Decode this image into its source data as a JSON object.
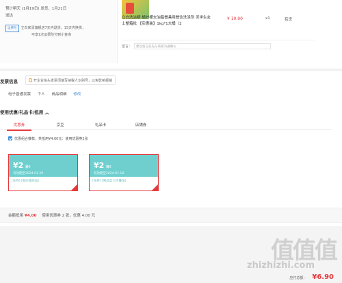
{
  "delivery": {
    "line1": "预计明天 (1月19日) 发货，1月21日",
    "line2": "送达"
  },
  "shipping": {
    "badge": "运费险",
    "line1": "立白家清旗舰店7天内退货，15天内换货，",
    "line2": "可享1次运费险付到小金库"
  },
  "product": {
    "title": "立白洗洁精 橘柠檬去油脂餐具用餐饮洗涤剂 灵学生女士整箱批 【实惠装】1kg*1大桶（2",
    "price": "¥ 10.90",
    "qty": "x1",
    "stock": "有货"
  },
  "remark": {
    "label": "留言：",
    "placeholder": "建议留言前先与商家沟通确认"
  },
  "invoice": {
    "title": "发票信息",
    "tip": "开企业抬头发票须填写纳税人识别号，以免影响报销",
    "type": "电子普通发票",
    "person": "个人",
    "detail": "商品明细",
    "edit": "修改"
  },
  "coupons": {
    "title": "使用优惠/礼品卡/抵用",
    "toggle": "︿",
    "tabs": [
      "优惠券",
      "京豆",
      "礼品卡",
      "店铺券"
    ],
    "recommend": "优惠组合推荐，共抵用¥4.00元：使用优惠券2张",
    "items": [
      {
        "amount": "¥2",
        "cond": "满0",
        "expiry": "有效期至2024-01-20",
        "tags": "[东券] [限店铺商品]"
      },
      {
        "amount": "¥2",
        "cond": "满0",
        "expiry": "有效期至2024-01-18",
        "tags": "[东券] [限品类] [可叠加]"
      }
    ]
  },
  "summary": {
    "label": "金额抵用",
    "amount": "¥4.00",
    "desc": "使用优惠券 2 张，优惠 4.00 元"
  },
  "total": {
    "label": "应付总额：",
    "amount": "¥6.90"
  },
  "watermark": {
    "big": "值值值",
    "url": "zhizhizhi.com"
  }
}
